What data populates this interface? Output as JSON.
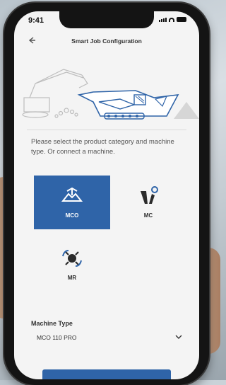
{
  "status_bar": {
    "time": "9:41"
  },
  "nav": {
    "title": "Smart Job Configuration",
    "back_icon": "arrow-left-icon"
  },
  "instruction": "Please select the product category and machine type. Or connect a machine.",
  "categories": [
    {
      "label": "MCO",
      "icon": "mco-icon",
      "selected": true
    },
    {
      "label": "MC",
      "icon": "mc-icon",
      "selected": false
    },
    {
      "label": "MR",
      "icon": "mr-icon",
      "selected": false
    }
  ],
  "machine_type": {
    "label": "Machine Type",
    "value": "MCO 110 PRO",
    "chevron": "chevron-down-icon"
  },
  "colors": {
    "accent": "#2f64a8",
    "background": "#f4f4f4",
    "text": "#333333",
    "muted": "#555555"
  }
}
